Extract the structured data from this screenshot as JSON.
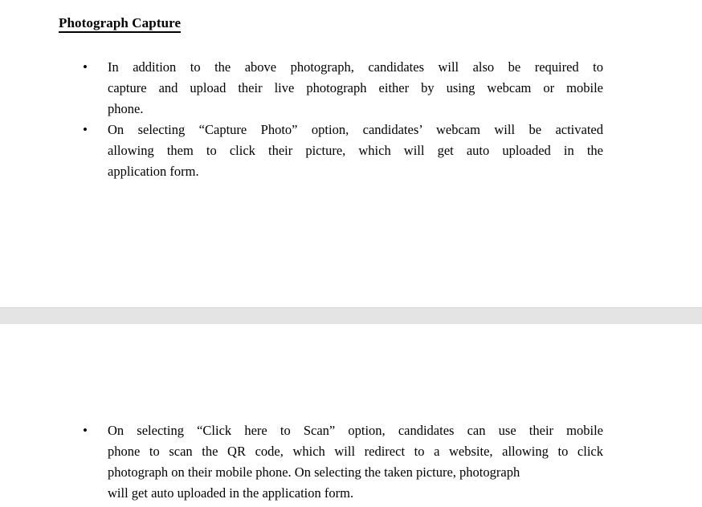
{
  "document": {
    "type": "scanned-pdf-page",
    "background_color": "#ffffff",
    "text_color": "#000000",
    "page_separator_color": "#e4e4e4"
  },
  "page_one": {
    "heading": "Photograph Capture",
    "bullets": [
      {
        "marker": "•",
        "text": "In addition to the above photograph, candidates will also be required to capture and upload their live photograph either by using webcam or mobile phone.",
        "lines": [
          "In addition to the above photograph, candidates will also be required to",
          "capture and upload their live photograph either by using webcam or mobile",
          "phone."
        ]
      },
      {
        "marker": "•",
        "text": "On selecting “Capture Photo” option, candidates’ webcam will be activated allowing them to click their picture, which will get auto uploaded in the application form.",
        "lines": [
          "On selecting “Capture Photo” option, candidates’ webcam will be activated",
          "allowing them to click their picture, which will get auto uploaded in the",
          "application form."
        ]
      }
    ]
  },
  "page_two": {
    "bullets": [
      {
        "marker": "•",
        "text": "On selecting “Click here to Scan” option, candidates can use their mobile phone to scan the QR code, which will redirect to a website, allowing to click photograph on their mobile phone. On selecting the taken picture, photograph will get auto uploaded in the application form.",
        "lines": [
          "On selecting “Click here to Scan” option, candidates can use their mobile",
          "phone to scan the QR code, which will redirect to a website, allowing to click",
          "photograph on their mobile phone. On selecting the taken picture, photograph",
          "will get auto uploaded in the application form."
        ]
      }
    ]
  }
}
